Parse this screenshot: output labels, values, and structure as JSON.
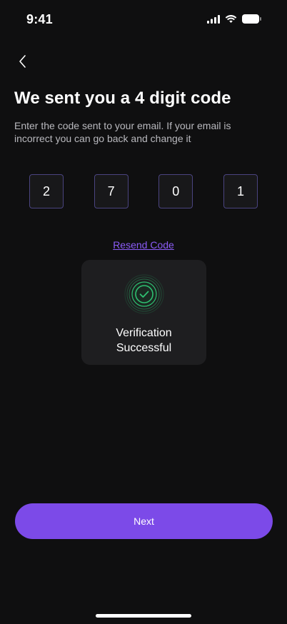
{
  "status_bar": {
    "time": "9:41",
    "icons": [
      "cellular-signal-icon",
      "wifi-icon",
      "battery-icon"
    ]
  },
  "header": {
    "back_icon": "chevron-left-icon",
    "title": "We sent you a 4 digit code",
    "subtitle": "Enter the code sent to your email. If your email is incorrect you can go back and change it"
  },
  "otp": {
    "digits": [
      "2",
      "7",
      "0",
      "1"
    ]
  },
  "resend": {
    "label": "Resend Code"
  },
  "success": {
    "icon": "check-circle-icon",
    "line1": "Verification",
    "line2": "Successful"
  },
  "footer": {
    "next_label": "Next"
  },
  "colors": {
    "background": "#0f0f10",
    "accent": "#7c4ae8",
    "link": "#8b5cf6",
    "success": "#2fbf71"
  }
}
